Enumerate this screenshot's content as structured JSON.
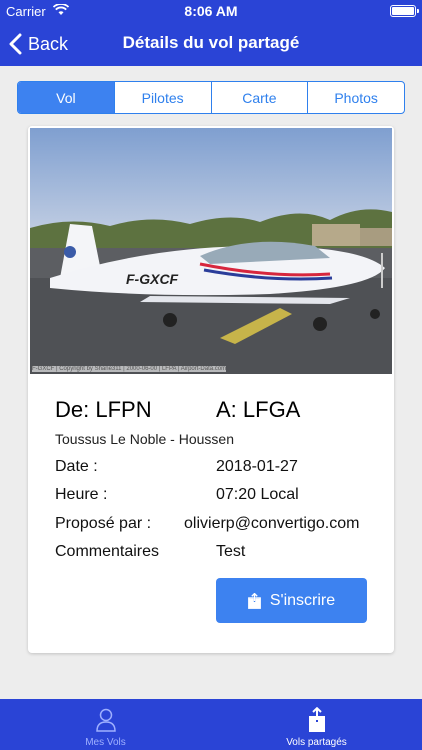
{
  "status_bar": {
    "carrier": "Carrier",
    "time": "8:06 AM"
  },
  "nav": {
    "back_label": "Back",
    "title": "Détails du vol partagé"
  },
  "tabs": [
    {
      "label": "Vol",
      "active": true
    },
    {
      "label": "Pilotes",
      "active": false
    },
    {
      "label": "Carte",
      "active": false
    },
    {
      "label": "Photos",
      "active": false
    }
  ],
  "flight": {
    "photo_registration": "F-GXCF",
    "photo_caption": "F-GXCF | Copyright by Shane311 | 2000-06-00 | LFPA | Airport-Data.com",
    "from": "De: LFPN",
    "to": "A: LFGA",
    "route_names": "Toussus Le Noble - Houssen",
    "rows": [
      {
        "label": "Date :",
        "value": "2018-01-27"
      },
      {
        "label": "Heure :",
        "value": "07:20 Local"
      },
      {
        "label": "Proposé par :",
        "value": "olivierp@convertigo.com"
      },
      {
        "label": "Commentaires",
        "value": "Test"
      }
    ],
    "signup_label": "S'inscrire"
  },
  "tabbar": [
    {
      "label": "Mes Vols",
      "icon": "person-icon",
      "active": false
    },
    {
      "label": "Vols partagés",
      "icon": "share-icon",
      "active": true
    }
  ],
  "colors": {
    "brand_blue": "#2a44d6",
    "accent": "#3d82f0"
  }
}
